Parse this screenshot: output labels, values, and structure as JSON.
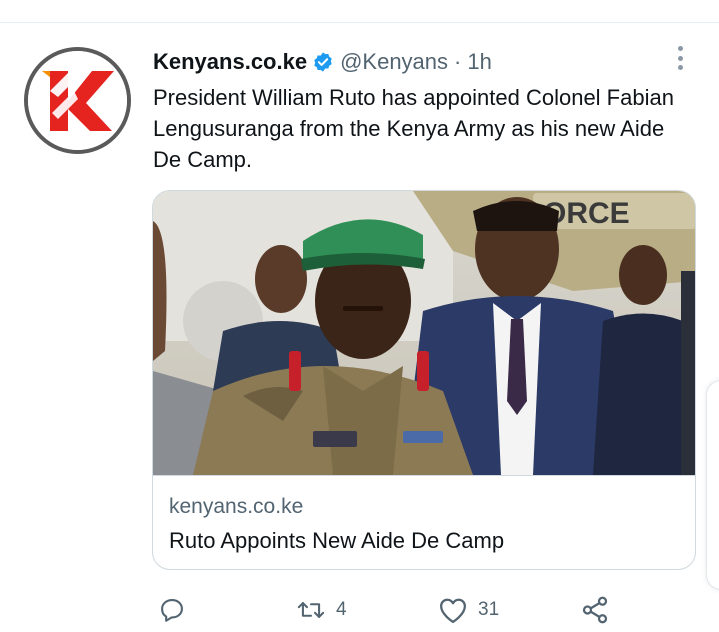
{
  "tweet": {
    "display_name": "Kenyans.co.ke",
    "verified_icon": "verified-badge-icon",
    "handle": "@Kenyans",
    "separator": "·",
    "time": "1h",
    "text": "President William Ruto has appointed Colonel Fabian Lengusuranga from the Kenya Army as his new Aide De Camp."
  },
  "card": {
    "domain": "kenyans.co.ke",
    "title": "Ruto Appoints New Aide De Camp",
    "image_sign_text": "ORCE"
  },
  "actions": {
    "reply": {
      "icon": "reply-icon",
      "count": ""
    },
    "retweet": {
      "icon": "retweet-icon",
      "count": "4"
    },
    "like": {
      "icon": "heart-icon",
      "count": "31"
    },
    "share": {
      "icon": "share-icon",
      "count": ""
    }
  },
  "colors": {
    "verified": "#1d9bf0",
    "brand_red": "#e52420",
    "brand_orange": "#f39200",
    "muted_text": "#536471"
  }
}
